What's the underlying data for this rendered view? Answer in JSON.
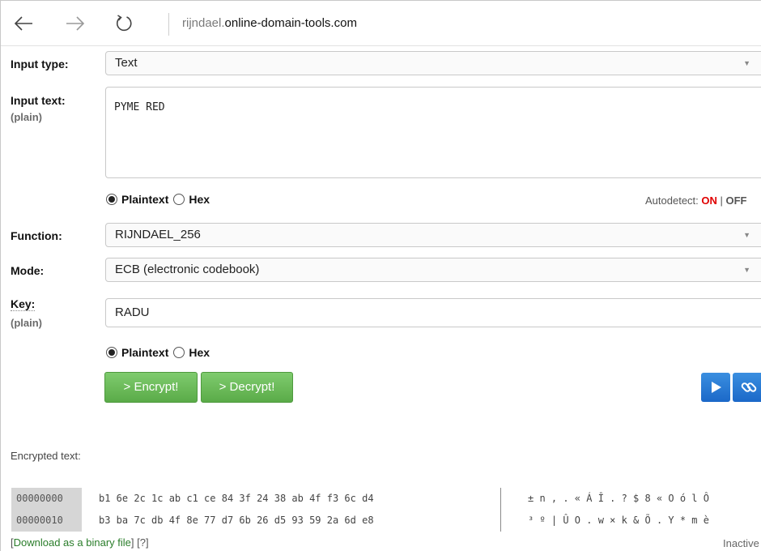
{
  "browser": {
    "address_sub": "rijndael.",
    "address_domain": "online-domain-tools.com"
  },
  "input_type": {
    "label": "Input type:",
    "value": "Text"
  },
  "input_text": {
    "label": "Input text:",
    "sublabel": "(plain)",
    "value": "PYME RED",
    "radio_plaintext": "Plaintext",
    "radio_hex": "Hex",
    "autodetect_label": "Autodetect: ",
    "autodetect_on": "ON",
    "autodetect_sep": " | ",
    "autodetect_off": "OFF"
  },
  "function": {
    "label": "Function:",
    "value": "RIJNDAEL_256"
  },
  "mode": {
    "label": "Mode:",
    "value": "ECB (electronic codebook)"
  },
  "key": {
    "label": "Key:",
    "sublabel": "(plain)",
    "value": "RADU",
    "radio_plaintext": "Plaintext",
    "radio_hex": "Hex"
  },
  "actions": {
    "encrypt_label": "> Encrypt!",
    "decrypt_label": "> Decrypt!"
  },
  "output": {
    "label": "Encrypted text:",
    "rows": [
      {
        "offset": "00000000",
        "bytes": "b1 6e 2c 1c ab c1 ce 84 3f 24 38 ab 4f f3 6c d4",
        "chars": "± n , . « Á Î . ? $ 8 « O ó l Ô"
      },
      {
        "offset": "00000010",
        "bytes": "b3 ba 7c db 4f 8e 77 d7 6b 26 d5 93 59 2a 6d e8",
        "chars": "³ º | Û O . w × k & Õ . Y * m è"
      }
    ],
    "download_open": "[",
    "download_link": "Download as a binary file",
    "download_close": "] ",
    "help_link": "[?]",
    "status": "Inactive"
  }
}
